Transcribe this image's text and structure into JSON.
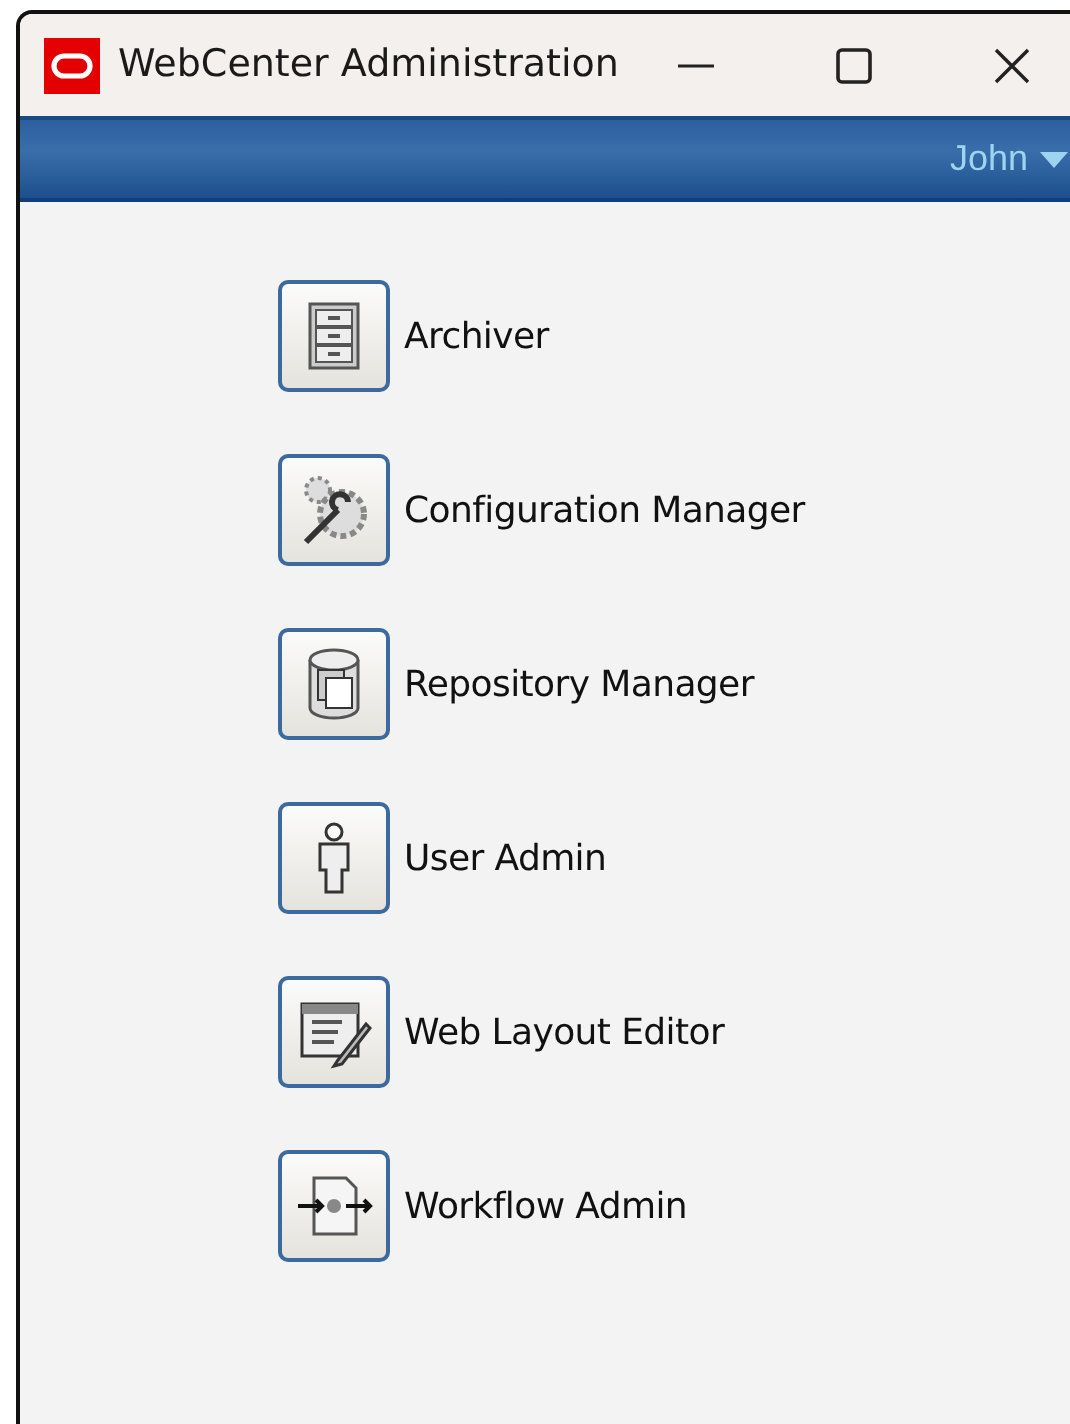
{
  "window": {
    "title": "WebCenter Administration"
  },
  "header": {
    "user": "John"
  },
  "items": [
    {
      "label": "Archiver",
      "kind": "cabinet"
    },
    {
      "label": "Configuration Manager",
      "kind": "gears"
    },
    {
      "label": "Repository Manager",
      "kind": "cylinder"
    },
    {
      "label": "User Admin",
      "kind": "person"
    },
    {
      "label": "Web Layout Editor",
      "kind": "editor"
    },
    {
      "label": "Workflow Admin",
      "kind": "flow"
    }
  ]
}
